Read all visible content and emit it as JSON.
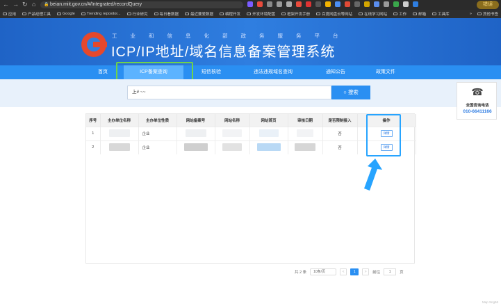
{
  "browser": {
    "url": "beian.miit.gov.cn/#/Integrated/recordQuery",
    "profile_label": "错误",
    "bookmarks": [
      "应用",
      "产品经理工具",
      "Google",
      "Trending repositor...",
      "行业研究",
      "每日看数据",
      "最近要爱数据",
      "编程开发",
      "开发环境配置",
      "框架开发手册",
      "百度网盘云等网站",
      "在线学习网站",
      "工作",
      "邮箱",
      "工具库"
    ],
    "bookmarks_right": "其他书签"
  },
  "banner": {
    "subtitle": "工业和信息化部政务服务平台",
    "title": "ICP/IP地址/域名信息备案管理系统"
  },
  "nav": {
    "items": [
      "首页",
      "ICP备案查询",
      "短信核验",
      "违法违规域名查询",
      "通知公告",
      "政策文件"
    ],
    "active_index": 1
  },
  "search": {
    "value": "上#          ~~",
    "button_label": "搜索"
  },
  "contact": {
    "label": "全国咨询电话",
    "phone": "010-66411166"
  },
  "table": {
    "headers": [
      "序号",
      "主办单位名称",
      "主办单位性质",
      "网站备案号",
      "网站名称",
      "网站首页",
      "审核日期",
      "是否限制接入",
      "操作"
    ],
    "rows": [
      {
        "index": "1",
        "unit_type": "企业",
        "restricted": "否",
        "action": "详情"
      },
      {
        "index": "2",
        "unit_type": "企业",
        "restricted": "否",
        "action": "详情"
      }
    ]
  },
  "pagination": {
    "total": "共 2 条",
    "page_size": "10条/页",
    "prev": "<",
    "current": "1",
    "next": ">",
    "goto_label": "前往",
    "goto_value": "1",
    "page_unit": "页"
  },
  "watermark": "Map Sng56"
}
